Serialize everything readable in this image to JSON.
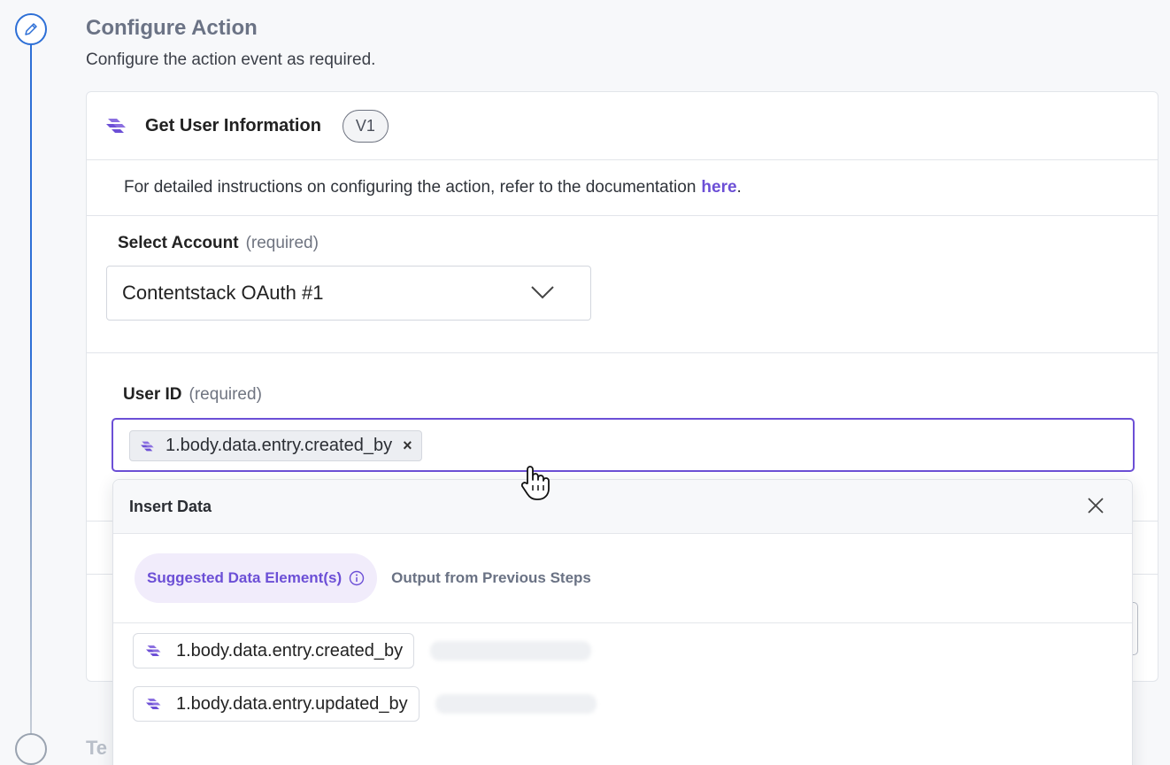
{
  "colors": {
    "accent": "#6c4fd6",
    "step_active": "#2d6fd6"
  },
  "step": {
    "title": "Configure Action",
    "subtitle": "Configure the action event as required.",
    "icon": "pencil-icon",
    "next_step_title": "Te"
  },
  "card": {
    "action_name": "Get User Information",
    "version": "V1",
    "doc_text": "For detailed instructions on configuring the action, refer to the documentation ",
    "doc_link": "here",
    "doc_suffix": "."
  },
  "account": {
    "label": "Select Account",
    "required": "(required)",
    "value": "Contentstack OAuth #1"
  },
  "user_id": {
    "label": "User ID",
    "required": "(required)",
    "token": "1.body.data.entry.created_by"
  },
  "popover": {
    "title": "Insert Data",
    "tabs": [
      {
        "label": "Suggested Data Element(s)",
        "active": true
      },
      {
        "label": "Output from Previous Steps",
        "active": false
      }
    ],
    "items": [
      {
        "label": "1.body.data.entry.created_by"
      },
      {
        "label": "1.body.data.entry.updated_by"
      }
    ]
  }
}
